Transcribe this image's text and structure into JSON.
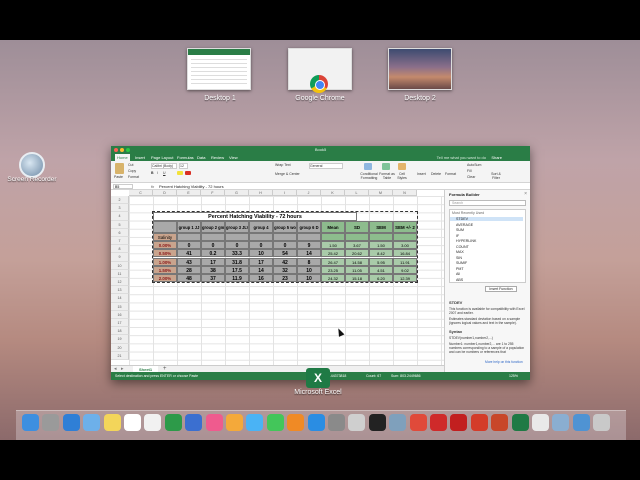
{
  "spaces": [
    {
      "label": "Desktop 1"
    },
    {
      "label": "Google Chrome"
    },
    {
      "label": "Desktop 2"
    }
  ],
  "desktop_icon": {
    "label": "Screen Recorder"
  },
  "excel": {
    "window_title": "Book5",
    "tabs": [
      "Home",
      "Insert",
      "Page Layout",
      "Formulas",
      "Data",
      "Review",
      "View"
    ],
    "tell_me": "Tell me what you want to do",
    "share": "Share",
    "ribbon": {
      "paste": "Paste",
      "cut": "Cut",
      "copy": "Copy",
      "format": "Format",
      "font": "Calibri (Body)",
      "font_size": "12",
      "wrap_text": "Wrap Text",
      "merge": "Merge & Center",
      "number_format": "General",
      "conditional_formatting": "Conditional Formatting",
      "format_as_table": "Format as Table",
      "cell_styles": "Cell Styles",
      "insert": "Insert",
      "delete": "Delete",
      "format_cells": "Format",
      "autosum": "AutoSum",
      "fill": "Fill",
      "clear": "Clear",
      "sort_filter": "Sort & Filter"
    },
    "name_box": "B5",
    "fx": "fx",
    "formula": "Percent Hatching Viability - 72 hours",
    "columns": [
      "C",
      "D",
      "E",
      "F",
      "G",
      "H",
      "I",
      "J",
      "K",
      "L",
      "M",
      "N"
    ],
    "rows": [
      "2",
      "3",
      "4",
      "5",
      "6",
      "7",
      "8",
      "9",
      "10",
      "11",
      "12",
      "13",
      "14",
      "15",
      "16",
      "17",
      "18",
      "19",
      "20",
      "21"
    ],
    "table": {
      "title": "Percent Hatching Viability - 72 hours",
      "header_label": "Salinity",
      "headers": [
        "group 1 JJ",
        "group 2 gm",
        "group 3 JLY",
        "group 4",
        "group 5 wo",
        "group 6 D",
        "Mean",
        "SD",
        "SEM",
        "SEM +/- 2"
      ],
      "rows": [
        {
          "salinity": "0.00%",
          "values": [
            "0",
            "0",
            "0",
            "0",
            "0",
            "9",
            "1.50",
            "3.67",
            "1.50",
            "3.00"
          ]
        },
        {
          "salinity": "0.50%",
          "values": [
            "41",
            "0.2",
            "33.3",
            "10",
            "54",
            "14",
            "25.42",
            "20.62",
            "8.42",
            "16.84"
          ]
        },
        {
          "salinity": "1.00%",
          "values": [
            "43",
            "17",
            "31.8",
            "17",
            "42",
            "8",
            "26.47",
            "14.58",
            "5.95",
            "11.91"
          ]
        },
        {
          "salinity": "1.50%",
          "values": [
            "28",
            "38",
            "17.5",
            "14",
            "32",
            "10",
            "23.25",
            "11.05",
            "4.51",
            "9.02"
          ]
        },
        {
          "salinity": "2.00%",
          "values": [
            "48",
            "37",
            "11.9",
            "16",
            "23",
            "10",
            "24.32",
            "15.18",
            "6.20",
            "12.39"
          ]
        }
      ]
    },
    "sheet_tab": "Sheet1",
    "status": {
      "left": "Select destination and press ENTER or choose Paste",
      "average": "Average: 15.44373818",
      "count": "Count: 67",
      "sum": "Sum: 803.2449686",
      "zoom": "125%"
    },
    "builder": {
      "title": "Formula Builder",
      "search_placeholder": "Search",
      "section": "Most Recently Used",
      "functions": [
        "STDEV",
        "AVERAGE",
        "SUM",
        "IF",
        "HYPERLINK",
        "COUNT",
        "MAX",
        "SIN",
        "SUMIF",
        "PMT",
        "All",
        "ABS"
      ],
      "insert_button": "Insert Function",
      "selected_name": "STDEV",
      "desc1": "This function is available for compatibility with Excel 2007 and earlier.",
      "desc2": "Estimates standard deviation based on a sample (ignores logical values and text in the sample).",
      "syntax_label": "Syntax",
      "syntax": "STDEV(number1,number2,...)",
      "arg_desc": "Number1: number1,number2,... are 1 to 255 numbers corresponding to a sample of a population and can be numbers or references that",
      "more_help": "More help on this function"
    }
  },
  "dock_label": "Microsoft Excel",
  "dock_icons": [
    "finder-icon",
    "launchpad-icon",
    "safari-icon",
    "mail-icon",
    "notes-icon",
    "calendar-icon",
    "reminders-icon",
    "numbers-icon",
    "keynote-icon",
    "itunes-icon",
    "photos-icon",
    "messages-icon",
    "facetime-icon",
    "ibooks-icon",
    "app-store-icon",
    "system-preferences-icon",
    "help-icon",
    "terminal-icon",
    "screen-recorder-icon",
    "chrome-icon",
    "acrobat-icon",
    "filezilla-icon",
    "toolbox-icon",
    "powerpoint-icon",
    "excel-icon",
    "document-icon",
    "folder-icon",
    "downloads-icon",
    "trash-icon"
  ]
}
